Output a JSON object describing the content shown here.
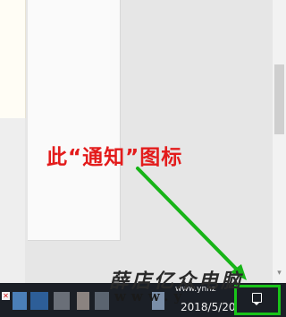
{
  "annotation": {
    "text": "此“通知”图标",
    "color": "#e31b1b",
    "arrow_color": "#17b417"
  },
  "watermark": {
    "text": "薛店亿众电脑",
    "url": "www.y"
  },
  "taskbar": {
    "tray_label": "www.ynnz",
    "date": "2018/5/20",
    "highlight_color": "#19c419",
    "notification_icon": "action-center-icon"
  }
}
